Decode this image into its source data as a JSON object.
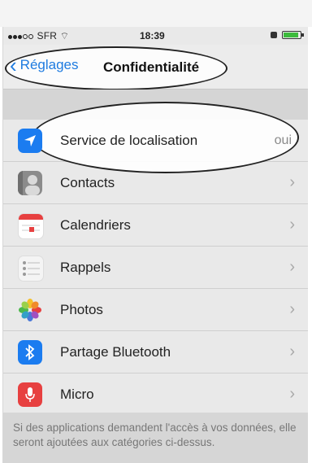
{
  "status_bar": {
    "carrier": "SFR",
    "time": "18:39"
  },
  "nav": {
    "back_label": "Réglages",
    "title": "Confidentialité"
  },
  "rows": [
    {
      "label": "Service de localisation",
      "value": "oui",
      "icon": "location-arrow-icon",
      "color": "#1b7cf0"
    },
    {
      "label": "Contacts",
      "icon": "contacts-icon",
      "color": "#8b8b8b"
    },
    {
      "label": "Calendriers",
      "icon": "calendar-icon",
      "color": "#e74040"
    },
    {
      "label": "Rappels",
      "icon": "reminders-icon",
      "color": "#f4f4f4"
    },
    {
      "label": "Photos",
      "icon": "photos-icon",
      "color": "#ffffff"
    },
    {
      "label": "Partage Bluetooth",
      "icon": "bluetooth-icon",
      "color": "#1b7cf0"
    },
    {
      "label": "Micro",
      "icon": "microphone-icon",
      "color": "#e74040"
    }
  ],
  "footer_text": "Si des applications demandent l'accès à vos données, elle seront ajoutées aux catégories ci-dessus."
}
